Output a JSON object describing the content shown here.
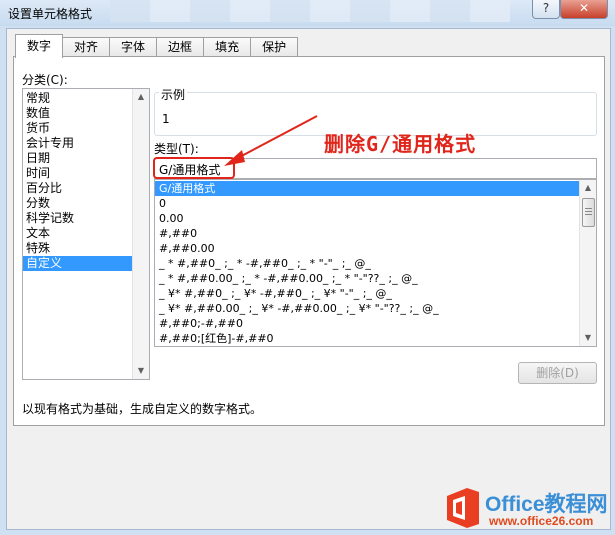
{
  "window": {
    "title": "设置单元格格式",
    "help_label": "?",
    "close_label": "✕"
  },
  "tabs": [
    {
      "label": "数字"
    },
    {
      "label": "对齐"
    },
    {
      "label": "字体"
    },
    {
      "label": "边框"
    },
    {
      "label": "填充"
    },
    {
      "label": "保护"
    }
  ],
  "category": {
    "label": "分类(C):",
    "items": [
      "常规",
      "数值",
      "货币",
      "会计专用",
      "日期",
      "时间",
      "百分比",
      "分数",
      "科学记数",
      "文本",
      "特殊",
      "自定义"
    ],
    "selected": "自定义"
  },
  "sample": {
    "label": "示例",
    "value": "1"
  },
  "type": {
    "label": "类型(T):",
    "value": "G/通用格式",
    "formats": [
      "G/通用格式",
      "0",
      "0.00",
      "#,##0",
      "#,##0.00",
      "_ * #,##0_ ;_ * -#,##0_ ;_ * \"-\"_ ;_ @_",
      "_ * #,##0.00_ ;_ * -#,##0.00_ ;_ * \"-\"??_ ;_ @_",
      "_ ¥* #,##0_ ;_ ¥* -#,##0_ ;_ ¥* \"-\"_ ;_ @_",
      "_ ¥* #,##0.00_ ;_ ¥* -#,##0.00_ ;_ ¥* \"-\"??_ ;_ @_",
      "#,##0;-#,##0",
      "#,##0;[红色]-#,##0"
    ],
    "selected_index": 0
  },
  "delete_button": {
    "label": "删除(D)",
    "enabled": false
  },
  "description": "以现有格式为基础，生成自定义的数字格式。",
  "annotation": {
    "text": "删除G/通用格式",
    "color": "#e0261b"
  },
  "watermark": {
    "brand": "Office教程网",
    "url": "www.office26.com"
  },
  "icons": {
    "logo": "office-logo-icon",
    "arrow": "annotation-arrow-icon"
  }
}
